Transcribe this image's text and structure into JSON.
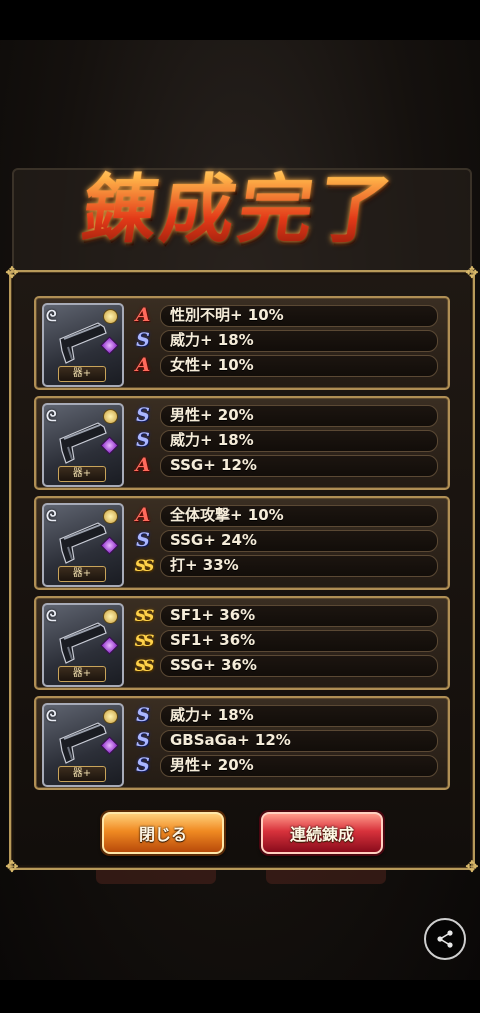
{
  "title": "錬成完了",
  "item_tag": "器+",
  "cards": [
    {
      "rows": [
        {
          "rank": "A",
          "text": "性別不明+ 10%"
        },
        {
          "rank": "S",
          "text": "威力+ 18%"
        },
        {
          "rank": "A",
          "text": "女性+ 10%"
        }
      ]
    },
    {
      "rows": [
        {
          "rank": "S",
          "text": "男性+ 20%"
        },
        {
          "rank": "S",
          "text": "威力+ 18%"
        },
        {
          "rank": "A",
          "text": "SSG+ 12%"
        }
      ]
    },
    {
      "rows": [
        {
          "rank": "A",
          "text": "全体攻撃+ 10%"
        },
        {
          "rank": "S",
          "text": "SSG+ 24%"
        },
        {
          "rank": "SS",
          "text": "打+ 33%"
        }
      ]
    },
    {
      "rows": [
        {
          "rank": "SS",
          "text": "SF1+ 36%"
        },
        {
          "rank": "SS",
          "text": "SF1+ 36%"
        },
        {
          "rank": "SS",
          "text": "SSG+ 36%"
        }
      ]
    },
    {
      "rows": [
        {
          "rank": "S",
          "text": "威力+ 18%"
        },
        {
          "rank": "S",
          "text": "GBSaGa+ 12%"
        },
        {
          "rank": "S",
          "text": "男性+ 20%"
        }
      ]
    }
  ],
  "buttons": {
    "close": "閉じる",
    "repeat": "連続錬成"
  },
  "icons": {
    "share": "share-icon",
    "weapon": "pistol-icon",
    "gem": "purple-gem-icon",
    "coin": "gold-coin-icon"
  },
  "colors": {
    "frame_gold": "#b89a5a",
    "rank_A": "#ff6a5c",
    "rank_S": "#aab6ff",
    "rank_SS": "#ffd24a"
  }
}
